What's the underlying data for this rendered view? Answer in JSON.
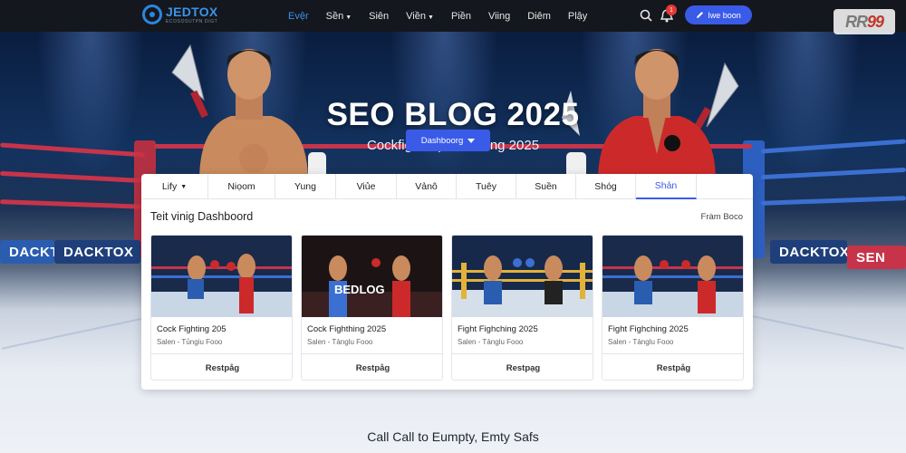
{
  "nav": {
    "brand_name": "JEDTOX",
    "brand_tagline": "ECOSOSUTPN DIGT",
    "links": [
      "Evệr",
      "Sền",
      "Siên",
      "Viền",
      "Piền",
      "Viing",
      "Diêm",
      "Plậy"
    ],
    "active_link": 0,
    "notification_count": "1",
    "cta_label": "Iwe boon"
  },
  "site_badge": {
    "prefix": "RR",
    "suffix": "99"
  },
  "hero": {
    "title": "SEO BLOG 2025",
    "subtitle": "Cockfightin platforming 2025",
    "button_label": "Dashboorg"
  },
  "ring_banners": [
    "DACKTOK",
    "DACKTOX",
    "DACKTOX",
    "SEN"
  ],
  "tabs": [
    "Lify",
    "Niọom",
    "Yung",
    "Viủe",
    "Vảnô",
    "Tuêy",
    "Suền",
    "Shóg",
    "Shản"
  ],
  "active_tab": 8,
  "dashboard": {
    "title": "Teit vinig Dashboord",
    "link": "Fràm Boco"
  },
  "cards": [
    {
      "title": "Cock Fighting 205",
      "meta": "Salen - Tủngiu Fooo",
      "button": "Restpåg",
      "image_label": ""
    },
    {
      "title": "Cock Fighthing 2025",
      "meta": "Salen - Tảnglu Fooo",
      "button": "Restpåg",
      "image_label": "BEDLOG"
    },
    {
      "title": "Fight Fighching 2025",
      "meta": "Salen - Tảnglu Fooo",
      "button": "Restpạg",
      "image_label": ""
    },
    {
      "title": "Fight Fighching 2025",
      "meta": "Salen - Tảnglu Fooo",
      "button": "Restpåg",
      "image_label": ""
    }
  ],
  "footer_cta": "Call Call to Eumpty, Emty Safs",
  "colors": {
    "accent": "#3a5be8",
    "brand": "#3b93ea",
    "nav_bg": "#14171d",
    "red_corner": "#c7344a",
    "blue_corner": "#3b6fd1"
  },
  "icons": [
    "search-icon",
    "bell-icon",
    "pen-icon",
    "chevron-down-icon",
    "knife-icon"
  ]
}
